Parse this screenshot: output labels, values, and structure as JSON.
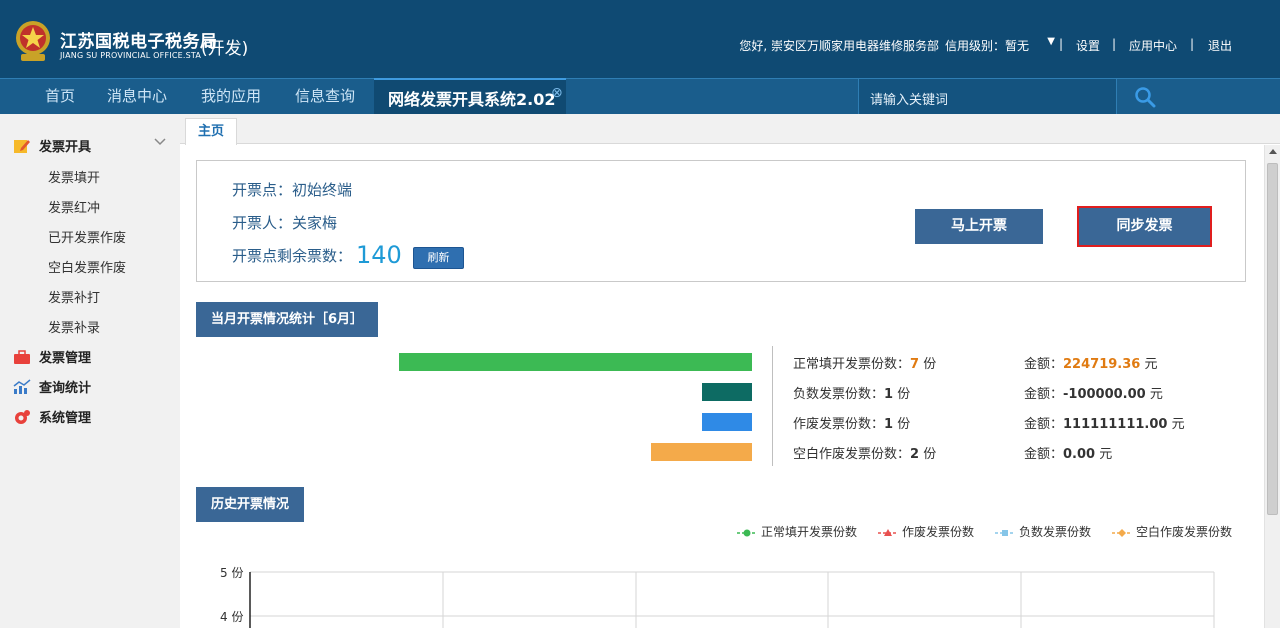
{
  "header": {
    "title": "江苏国税电子税务局",
    "subtitle": "JIANG SU PROVINCIAL OFFICE.STA",
    "env": "(开发)",
    "greeting": "您好, 崇安区万顺家用电器维修服务部",
    "credit": "信用级别：暂无",
    "settings": "设置",
    "app_center": "应用中心",
    "logout": "退出",
    "sep": "|"
  },
  "nav": {
    "items": [
      "首页",
      "消息中心",
      "我的应用",
      "信息查询"
    ],
    "active": "网络发票开具系统2.02",
    "search_placeholder": "请输入关键词"
  },
  "sidebar": {
    "group1": "发票开具",
    "items": [
      "发票填开",
      "发票红冲",
      "已开发票作废",
      "空白发票作废",
      "发票补打",
      "发票补录"
    ],
    "group2": "发票管理",
    "group3": "查询统计",
    "group4": "系统管理"
  },
  "tabs": {
    "home": "主页"
  },
  "info": {
    "point_label": "开票点：",
    "point_value": "初始终端",
    "issuer_label": "开票人：",
    "issuer_value": "关家梅",
    "remaining_label": "开票点剩余票数：",
    "remaining_count": "140",
    "refresh": "刷新",
    "issue_now": "马上开票",
    "sync": "同步发票"
  },
  "monthly": {
    "title": "当月开票情况统计［6月］",
    "stats": [
      {
        "label": "正常填开发票份数：",
        "count": "7",
        "unit": "份",
        "amount_label": "金额：",
        "amount": "224719.36",
        "currency": "元",
        "color": "#3cba54",
        "bar_fraction": 1.0
      },
      {
        "label": "负数发票份数：",
        "count": "1",
        "unit": "份",
        "amount_label": "金额：",
        "amount": "-100000.00",
        "currency": "元",
        "color": "#0d6b63",
        "bar_fraction": 0.143
      },
      {
        "label": "作废发票份数：",
        "count": "1",
        "unit": "份",
        "amount_label": "金额：",
        "amount": "111111111.00",
        "currency": "元",
        "color": "#2f8ae6",
        "bar_fraction": 0.143
      },
      {
        "label": "空白作废发票份数：",
        "count": "2",
        "unit": "份",
        "amount_label": "金额：",
        "amount": "0.00",
        "currency": "元",
        "color": "#f4aa4a",
        "bar_fraction": 0.286
      }
    ]
  },
  "history": {
    "title": "历史开票情况",
    "legend": [
      {
        "label": "正常填开发票份数",
        "color": "#3cba54",
        "marker": "circle"
      },
      {
        "label": "作废发票份数",
        "color": "#e8504f",
        "marker": "triangle"
      },
      {
        "label": "负数发票份数",
        "color": "#86c5e8",
        "marker": "square"
      },
      {
        "label": "空白作废发票份数",
        "color": "#f4aa4a",
        "marker": "diamond"
      }
    ],
    "y_ticks": [
      "5 份",
      "4 份"
    ]
  }
}
